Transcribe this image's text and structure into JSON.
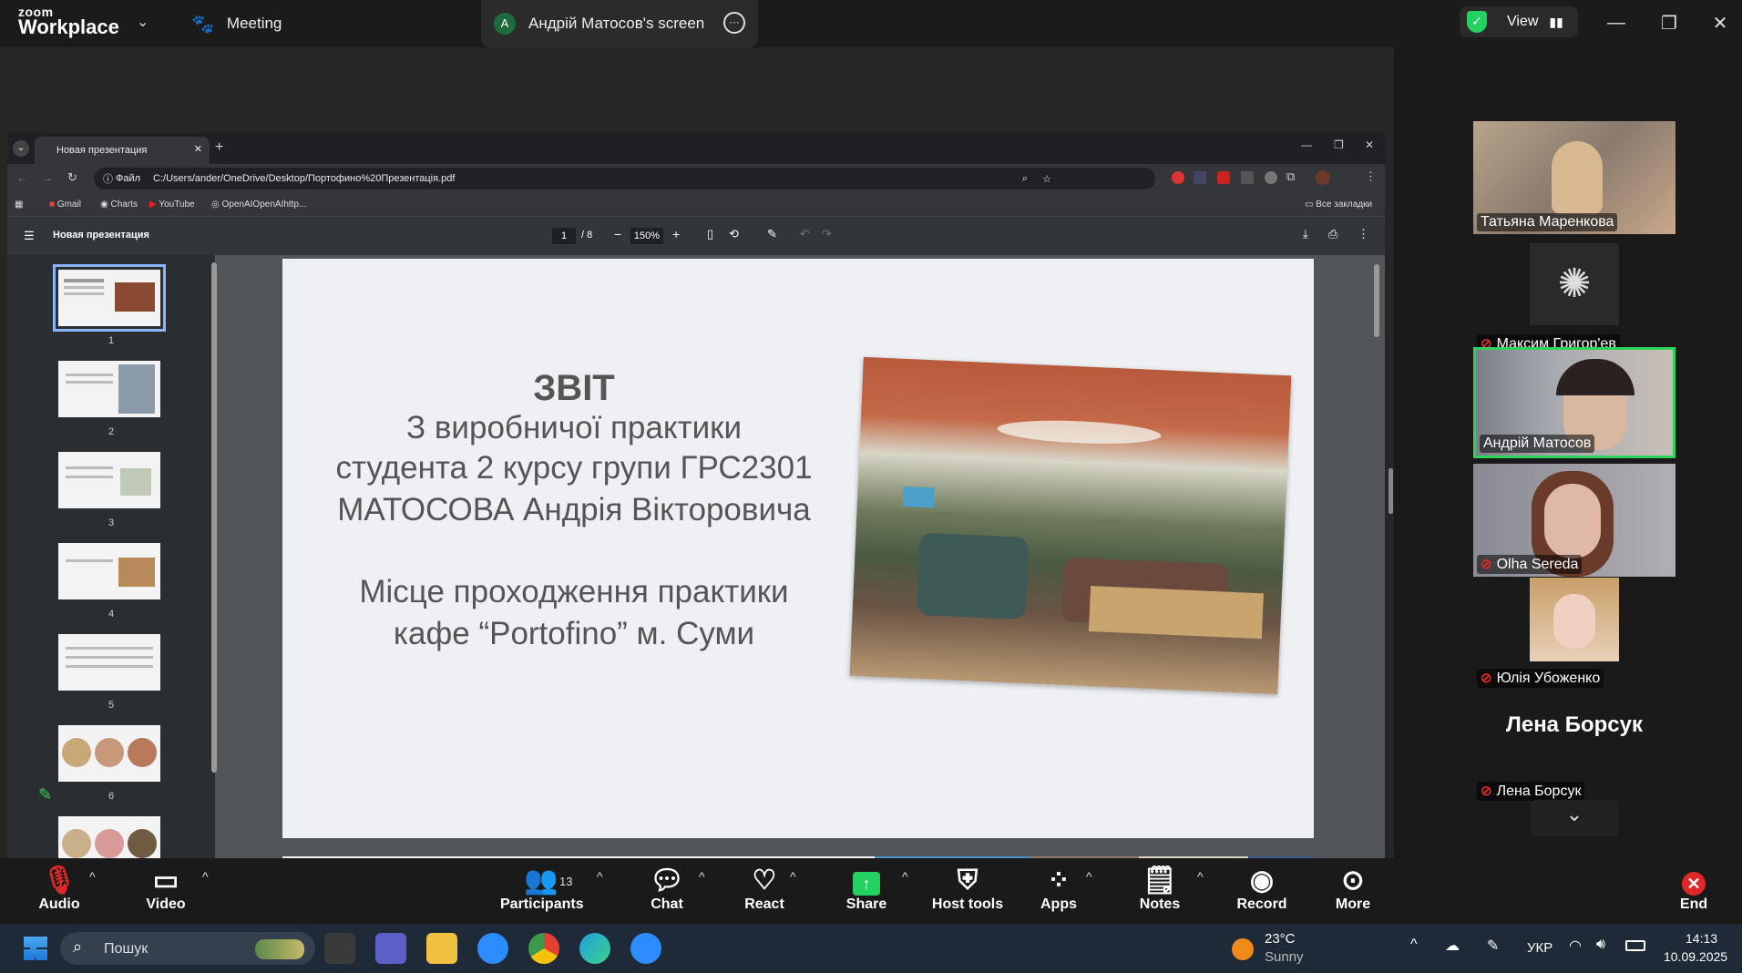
{
  "zoom": {
    "logo_line1": "zoom",
    "logo_line2": "Workplace",
    "tab_meeting": "Meeting",
    "tab_screen_initial": "A",
    "tab_screen": "Андрій Матосов's screen",
    "view_label": "View"
  },
  "browser": {
    "tab_title": "Новая презентация",
    "file_label": "Файл",
    "url": "C:/Users/ander/OneDrive/Desktop/Портофино%20Презентація.pdf",
    "bookmarks": [
      "Gmail",
      "Charts",
      "YouTube",
      "OpenAIOpenAIhttp..."
    ],
    "all_bookmarks": "Все закладки",
    "pdf_title": "Новая презентация",
    "page_current": "1",
    "page_total": "/ 8",
    "zoom_level": "150%",
    "thumb_numbers": [
      "1",
      "2",
      "3",
      "4",
      "5",
      "6"
    ]
  },
  "slide": {
    "title": "ЗВІТ",
    "line1": "З виробничої практики",
    "line2": "студента 2 курсу групи ГРС2301",
    "line3": "МАТОСОВА Андрія Вікторовича",
    "line4": "Місце проходження практики",
    "line5": "кафе “Portofino” м. Суми"
  },
  "participants": [
    {
      "name": "Татьяна Маренкова",
      "muted": false
    },
    {
      "name": "Максим Григор'ев",
      "muted": true
    },
    {
      "name": "Андрій Матосов",
      "muted": false,
      "active_speaker": true
    },
    {
      "name": "Olha Sereda",
      "muted": true
    },
    {
      "name": "Юлія Убоженко",
      "muted": true
    },
    {
      "name": "Лена Борсук",
      "muted": true,
      "no_video": true
    }
  ],
  "no_video_big_name": "Лена Борсук",
  "controls": {
    "audio": "Audio",
    "video": "Video",
    "participants": "Participants",
    "participants_count": "13",
    "chat": "Chat",
    "react": "React",
    "share": "Share",
    "host_tools": "Host tools",
    "apps": "Apps",
    "notes": "Notes",
    "record": "Record",
    "more": "More",
    "end": "End"
  },
  "taskbar": {
    "search_placeholder": "Пошук",
    "weather_temp": "23°C",
    "weather_desc": "Sunny",
    "language": "УКР",
    "time": "14:13",
    "date": "10.09.2025"
  },
  "colors": {
    "active_speaker_border": "#2fd35c",
    "share_green": "#23d160",
    "end_red": "#e02828"
  }
}
